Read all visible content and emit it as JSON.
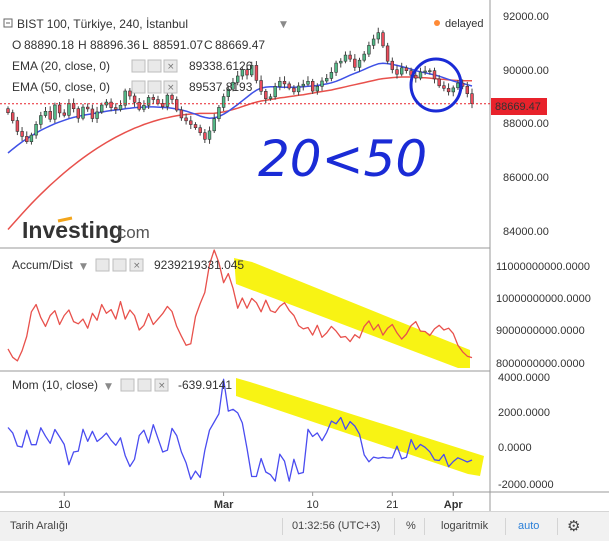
{
  "header": {
    "title": "BIST 100, Türkiye, 240, İstanbul",
    "status": "delayed",
    "ohlc": {
      "o_label": "O",
      "o": "88890.18",
      "h_label": "H",
      "h": "88896.36",
      "l_label": "L",
      "l": "88591.07",
      "c_label": "C",
      "c": "88669.47"
    },
    "ema20": {
      "label": "EMA (20, close, 0)",
      "value": "89338.6126"
    },
    "ema50": {
      "label": "EMA (50, close, 0)",
      "value": "89537.8193"
    },
    "logo_main": "Investing",
    "logo_suffix": ".com"
  },
  "annotation": {
    "handwritten": "20<50"
  },
  "price_axis": {
    "ticks": [
      "92000.00",
      "90000.00",
      "88000.00",
      "86000.00",
      "84000.00"
    ],
    "current": "88669.47"
  },
  "accum": {
    "label": "Accum/Dist",
    "value": "9239219331.045",
    "ticks": [
      "11000000000.0000",
      "10000000000.0000",
      "9000000000.0000",
      "8000000000.0000"
    ]
  },
  "mom": {
    "label": "Mom (10, close)",
    "value": "-639.9141",
    "ticks": [
      "4000.0000",
      "2000.0000",
      "0.0000",
      "-2000.0000"
    ]
  },
  "xaxis": {
    "ticks": [
      "10",
      "Mar",
      "10",
      "21",
      "Apr"
    ]
  },
  "bottom": {
    "range": "Tarih Aralığı",
    "time": "01:32:56 (UTC+3)",
    "percent": "%",
    "log": "logaritmik",
    "auto": "auto"
  },
  "colors": {
    "up": "#53b987",
    "down": "#eb4d5c",
    "ema20": "#3f51e6",
    "ema50": "#e8514c",
    "accum": "#e8514c",
    "mom": "#4a4cf0",
    "highlight": "#f7f200",
    "annotation": "#1a2bd6",
    "current_tag": "#e8222b"
  },
  "chart_data": [
    {
      "type": "candlestick",
      "title": "BIST 100, Türkiye, 240, İstanbul",
      "ylim": [
        83200,
        92600
      ],
      "x_ticks": [
        "10",
        "Mar",
        "10",
        "21",
        "Apr"
      ],
      "close": [
        88330,
        88030,
        87620,
        87430,
        87230,
        87480,
        87890,
        88220,
        88380,
        88080,
        88620,
        88320,
        88230,
        88680,
        88480,
        88120,
        88540,
        88470,
        88110,
        88360,
        88620,
        88730,
        88520,
        88450,
        88610,
        89150,
        88960,
        88720,
        88460,
        88610,
        88910,
        88830,
        88680,
        88560,
        88990,
        88830,
        88430,
        88130,
        88020,
        87880,
        87760,
        87570,
        87320,
        87640,
        88100,
        88530,
        88940,
        89220,
        89480,
        89720,
        89960,
        89760,
        90120,
        89550,
        89140,
        88860,
        88930,
        89320,
        89520,
        89420,
        89260,
        89120,
        89340,
        89410,
        89520,
        89150,
        89330,
        89530,
        89630,
        89860,
        90210,
        90280,
        90510,
        90360,
        90050,
        90320,
        90550,
        90880,
        91120,
        91360,
        90860,
        90280,
        89960,
        89790,
        90030,
        89920,
        89750,
        89640,
        89870,
        89910,
        89920,
        89610,
        89350,
        89250,
        89120,
        89270,
        89450,
        89330,
        89050,
        88670
      ],
      "ema20": [
        86800,
        86950,
        87090,
        87220,
        87340,
        87450,
        87560,
        87660,
        87750,
        87830,
        87910,
        87980,
        88040,
        88100,
        88150,
        88190,
        88230,
        88260,
        88290,
        88320,
        88350,
        88380,
        88410,
        88430,
        88450,
        88480,
        88500,
        88520,
        88530,
        88540,
        88550,
        88550,
        88540,
        88530,
        88520,
        88500,
        88470,
        88430,
        88390,
        88330,
        88270,
        88200,
        88150,
        88120,
        88130,
        88180,
        88270,
        88380,
        88510,
        88640,
        88780,
        88920,
        89060,
        89180,
        89260,
        89300,
        89310,
        89310,
        89300,
        89290,
        89290,
        89290,
        89300,
        89310,
        89330,
        89340,
        89360,
        89390,
        89420,
        89460,
        89520,
        89590,
        89670,
        89750,
        89820,
        89890,
        89970,
        90050,
        90120,
        90180,
        90200,
        90190,
        90160,
        90120,
        90080,
        90030,
        89980,
        89920,
        89880,
        89840,
        89800,
        89760,
        89710,
        89650,
        89590,
        89530,
        89480,
        89440,
        89390,
        89339
      ],
      "ema50": [
        83900,
        84100,
        84300,
        84500,
        84690,
        84880,
        85060,
        85240,
        85410,
        85580,
        85740,
        85900,
        86050,
        86200,
        86340,
        86480,
        86610,
        86740,
        86860,
        86980,
        87090,
        87200,
        87300,
        87400,
        87490,
        87580,
        87660,
        87740,
        87810,
        87880,
        87940,
        88000,
        88050,
        88100,
        88140,
        88180,
        88210,
        88240,
        88260,
        88280,
        88290,
        88300,
        88300,
        88300,
        88310,
        88330,
        88360,
        88400,
        88450,
        88500,
        88560,
        88620,
        88680,
        88730,
        88770,
        88800,
        88830,
        88860,
        88890,
        88910,
        88940,
        88960,
        88990,
        89010,
        89040,
        89070,
        89100,
        89130,
        89160,
        89190,
        89230,
        89270,
        89310,
        89350,
        89390,
        89430,
        89470,
        89510,
        89550,
        89590,
        89620,
        89640,
        89660,
        89670,
        89680,
        89680,
        89680,
        89670,
        89660,
        89650,
        89640,
        89620,
        89600,
        89590,
        89570,
        89560,
        89550,
        89540,
        89538,
        89537
      ]
    },
    {
      "type": "line",
      "title": "Accum/Dist",
      "ylim": [
        7900000000,
        11200000000
      ],
      "x_ticks": [
        "10",
        "Mar",
        "10",
        "21",
        "Apr"
      ],
      "series": [
        {
          "name": "Accum/Dist",
          "values": [
            8480000000,
            8250000000,
            8150000000,
            8430000000,
            8820000000,
            9500000000,
            9700000000,
            9340000000,
            9100000000,
            9400000000,
            9530000000,
            9150000000,
            9400000000,
            9550000000,
            9230000000,
            9170000000,
            9300000000,
            9050000000,
            9460000000,
            9270000000,
            9700000000,
            9460000000,
            9560000000,
            9300000000,
            9780000000,
            9300000000,
            9550000000,
            9400000000,
            9000000000,
            9130000000,
            9450000000,
            9150000000,
            9300000000,
            9450000000,
            9650000000,
            9510000000,
            9100000000,
            8830000000,
            8580000000,
            8620000000,
            9370000000,
            9730000000,
            10030000000,
            10800000000,
            11200000000,
            10850000000,
            10300000000,
            10550000000,
            10150000000,
            9600000000,
            9880000000,
            9600000000,
            9870000000,
            9750000000,
            9500000000,
            9820000000,
            9530000000,
            9480000000,
            9650000000,
            9750000000,
            9540000000,
            9400000000,
            9120000000,
            9030000000,
            9070000000,
            8860000000,
            9130000000,
            8800000000,
            8920000000,
            9100000000,
            8970000000,
            8800000000,
            8820000000,
            8680000000,
            8870000000,
            8780000000,
            9100000000,
            9250000000,
            9000000000,
            9150000000,
            8860000000,
            9050000000,
            9150000000,
            8920000000,
            8750000000,
            8890000000,
            9120000000,
            9230000000,
            8970000000,
            8960000000,
            8850000000,
            9030000000,
            9130000000,
            9000000000,
            9050000000,
            8900000000,
            8580000000,
            8400000000,
            8280000000,
            8240000000
          ]
        }
      ]
    },
    {
      "type": "line",
      "title": "Mom (10, close)",
      "ylim": [
        -2400,
        4200
      ],
      "x_ticks": [
        "10",
        "Mar",
        "10",
        "21",
        "Apr"
      ],
      "series": [
        {
          "name": "Mom (10, close)",
          "values": [
            1150,
            850,
            130,
            70,
            1000,
            200,
            200,
            1130,
            670,
            280,
            1040,
            630,
            220,
            -900,
            -200,
            -150,
            1050,
            390,
            940,
            380,
            580,
            840,
            450,
            170,
            580,
            -400,
            -1000,
            -600,
            700,
            1000,
            300,
            1300,
            550,
            -200,
            -100,
            1100,
            700,
            -200,
            -800,
            -1700,
            -1250,
            -1600,
            -120,
            1000,
            1450,
            1900,
            3800,
            2050,
            2150,
            1950,
            1400,
            0,
            -1550,
            -1550,
            -560,
            -1300,
            -1450,
            -1800,
            -320,
            -700,
            -1800,
            -600,
            -1400,
            -1330,
            1050,
            650,
            850,
            420,
            880,
            1500,
            1350,
            1700,
            1050,
            1470,
            1230,
            780,
            -360,
            -740,
            -480,
            -540,
            -490,
            -530,
            -520,
            120,
            -580,
            -490,
            490,
            -70,
            220,
            60,
            -190,
            -630,
            -670,
            -330,
            -1010,
            -720,
            -520,
            -630,
            -750,
            -640
          ]
        }
      ]
    }
  ]
}
